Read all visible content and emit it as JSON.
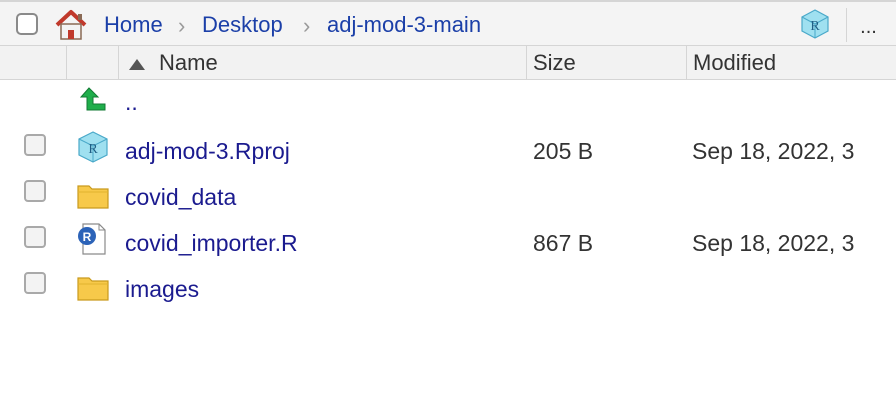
{
  "breadcrumb": {
    "items": [
      "Home",
      "Desktop",
      "adj-mod-3-main"
    ],
    "more_label": "...",
    "home_icon": "home-icon",
    "project_icon": "rproj-icon"
  },
  "columns": {
    "name": "Name",
    "size": "Size",
    "modified": "Modified",
    "sort_icon": "sort-ascending-icon"
  },
  "parent_row": {
    "label": "..",
    "icon": "go-up-arrow-icon"
  },
  "files": [
    {
      "name": "adj-mod-3.Rproj",
      "size": "205 B",
      "modified": "Sep 18, 2022, 3",
      "icon": "rproj-file-icon"
    },
    {
      "name": "covid_data",
      "size": "",
      "modified": "",
      "icon": "folder-icon"
    },
    {
      "name": "covid_importer.R",
      "size": "867 B",
      "modified": "Sep 18, 2022, 3",
      "icon": "r-script-icon"
    },
    {
      "name": "images",
      "size": "",
      "modified": "",
      "icon": "folder-icon"
    }
  ],
  "colors": {
    "link": "#1b3fa8",
    "filename": "#1b1b8f",
    "rproj_cube": "#7fd3ea",
    "up_arrow": "#1fae4b",
    "folder": "#f7c94a",
    "home_roof": "#c0392b"
  }
}
